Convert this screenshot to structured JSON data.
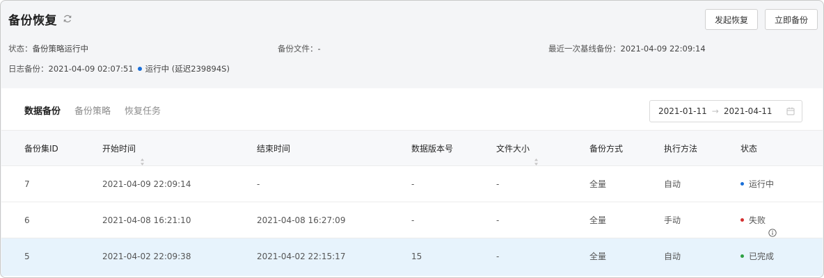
{
  "header": {
    "title": "备份恢复",
    "btn_initiate": "发起恢复",
    "btn_backup": "立即备份"
  },
  "info": {
    "status_label": "状态：",
    "status_value": "备份策略运行中",
    "file_label": "备份文件：",
    "file_value": "-",
    "baseline_label": "最近一次基线备份：",
    "baseline_value": "2021-04-09 22:09:14",
    "log_label": "日志备份：",
    "log_value": "2021-04-09 02:07:51",
    "log_status": "运行中 (延迟239894S)",
    "log_status_color": "#1a6fd8"
  },
  "tabs": [
    {
      "label": "数据备份",
      "active": true
    },
    {
      "label": "备份策略",
      "active": false
    },
    {
      "label": "恢复任务",
      "active": false
    }
  ],
  "range": {
    "start": "2021-01-11",
    "arrow": "→",
    "end": "2021-04-11"
  },
  "table": {
    "headers": [
      "备份集ID",
      "开始时间",
      "结束时间",
      "数据版本号",
      "文件大小",
      "备份方式",
      "执行方法",
      "状态"
    ],
    "rows": [
      {
        "id": "7",
        "start": "2021-04-09 22:09:14",
        "end": "-",
        "version": "-",
        "size": "-",
        "mode": "全量",
        "method": "自动",
        "status": "运行中",
        "status_color": "#1a6fd8",
        "selected": false
      },
      {
        "id": "6",
        "start": "2021-04-08 16:21:10",
        "end": "2021-04-08 16:27:09",
        "version": "-",
        "size": "-",
        "mode": "全量",
        "method": "手动",
        "status": "失败",
        "status_color": "#d43030",
        "selected": false
      },
      {
        "id": "5",
        "start": "2021-04-02 22:09:38",
        "end": "2021-04-02 22:15:17",
        "version": "15",
        "size": "-",
        "mode": "全量",
        "method": "自动",
        "status": "已完成",
        "status_color": "#2ea043",
        "selected": true
      }
    ]
  },
  "icons": {
    "refresh": "refresh-icon",
    "calendar": "calendar-icon",
    "sort": "sort-icon",
    "info": "info-icon"
  }
}
